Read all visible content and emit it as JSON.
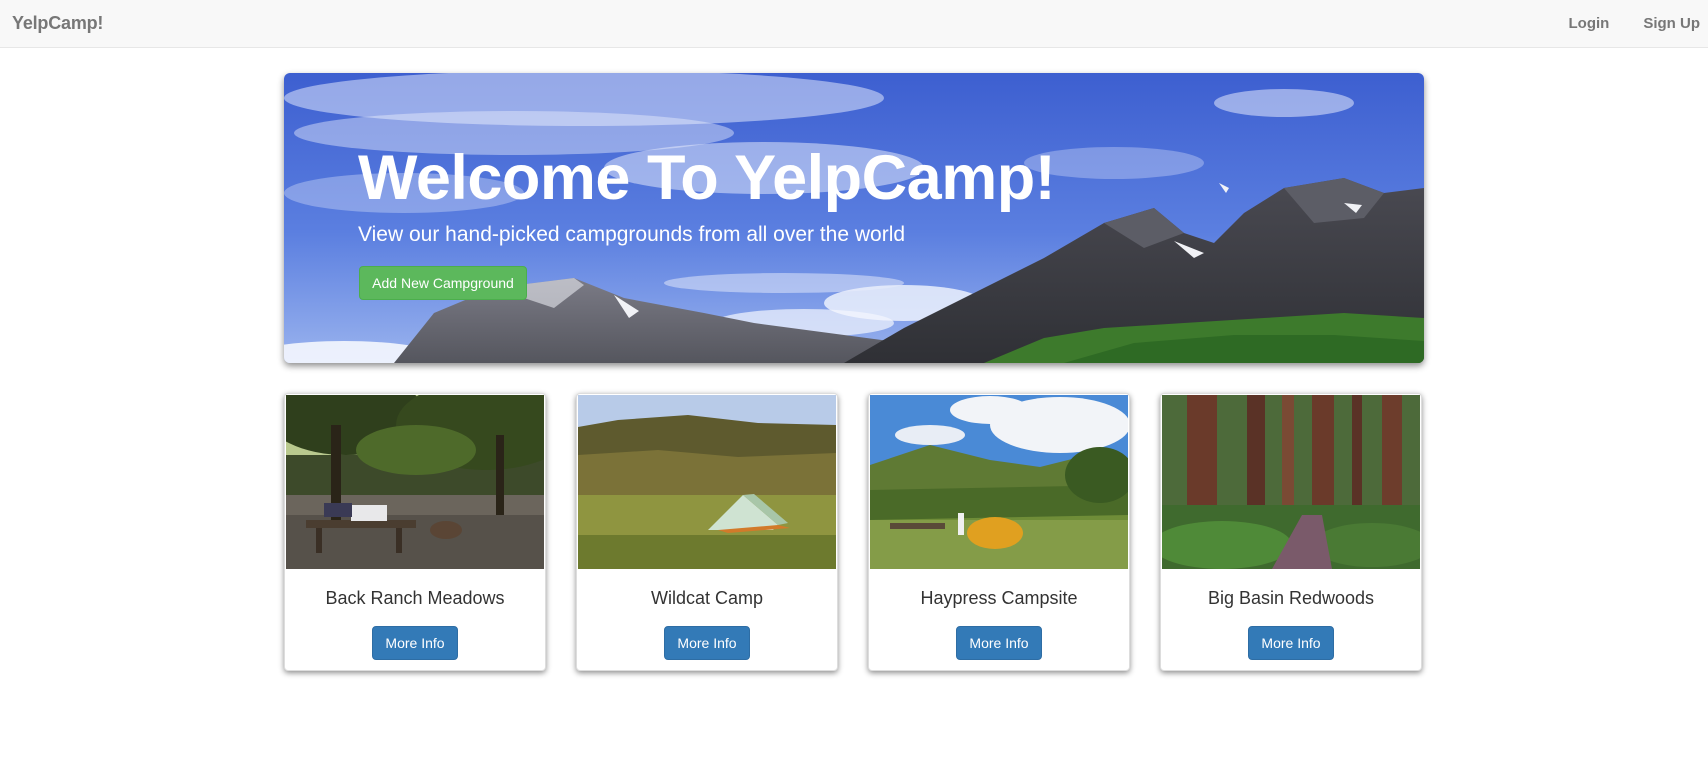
{
  "navbar": {
    "brand": "YelpCamp!",
    "login_label": "Login",
    "signup_label": "Sign Up"
  },
  "jumbotron": {
    "title": "Welcome To YelpCamp!",
    "subtitle": "View our hand-picked campgrounds from all over the world",
    "add_button_label": "Add New Campground"
  },
  "campgrounds": [
    {
      "name": "Back Ranch Meadows",
      "button_label": "More Info"
    },
    {
      "name": "Wildcat Camp",
      "button_label": "More Info"
    },
    {
      "name": "Haypress Campsite",
      "button_label": "More Info"
    },
    {
      "name": "Big Basin Redwoods",
      "button_label": "More Info"
    }
  ],
  "colors": {
    "navbar_bg": "#f8f8f8",
    "success_button": "#5cb85c",
    "primary_button": "#337ab7"
  }
}
